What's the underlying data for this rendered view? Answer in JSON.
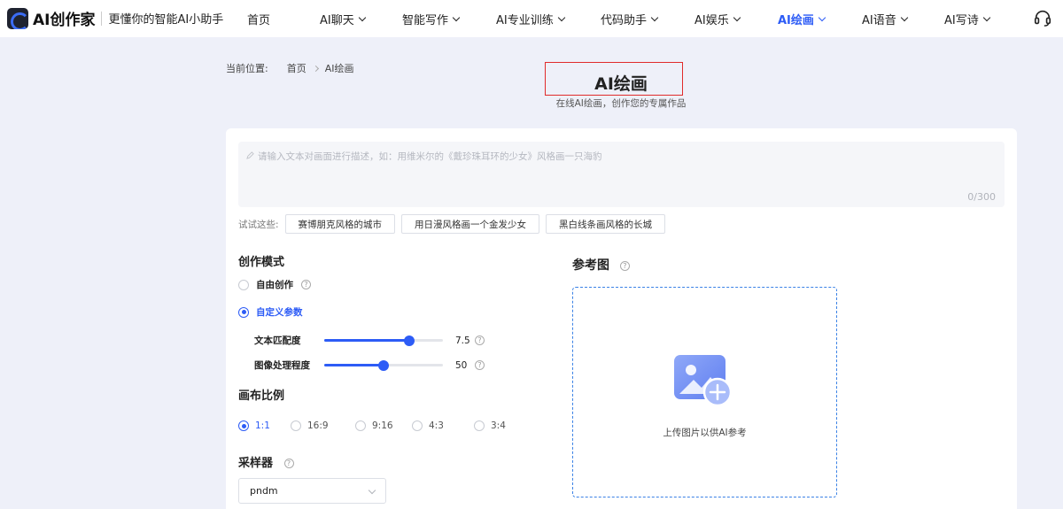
{
  "brand": {
    "name": "AI创作家",
    "slogan": "更懂你的智能AI小助手"
  },
  "nav": {
    "items": [
      {
        "label": "首页",
        "dropdown": false,
        "active": false
      },
      {
        "label": "AI聊天",
        "dropdown": true,
        "active": false
      },
      {
        "label": "智能写作",
        "dropdown": true,
        "active": false
      },
      {
        "label": "AI专业训练",
        "dropdown": true,
        "active": false
      },
      {
        "label": "代码助手",
        "dropdown": true,
        "active": false
      },
      {
        "label": "AI娱乐",
        "dropdown": true,
        "active": false
      },
      {
        "label": "AI绘画",
        "dropdown": true,
        "active": true
      },
      {
        "label": "AI语音",
        "dropdown": true,
        "active": false
      },
      {
        "label": "AI写诗",
        "dropdown": true,
        "active": false
      }
    ],
    "support_icon": "headset-icon"
  },
  "breadcrumb": {
    "prefix": "当前位置:",
    "items": [
      "首页",
      "AI绘画"
    ]
  },
  "page": {
    "title": "AI绘画",
    "subtitle": "在线AI绘画，创作您的专属作品"
  },
  "prompt": {
    "placeholder": "请输入文本对画面进行描述，如：用维米尔的《戴珍珠耳环的少女》风格画一只海豹",
    "value": "",
    "count": "0/300"
  },
  "suggestions": {
    "label": "试试这些:",
    "items": [
      "赛博朋克风格的城市",
      "用日漫风格画一个金发少女",
      "黑白线条画风格的长城"
    ]
  },
  "mode": {
    "title": "创作模式",
    "options": [
      {
        "label": "自由创作",
        "checked": false
      },
      {
        "label": "自定义参数",
        "checked": true
      }
    ]
  },
  "params": {
    "text_match": {
      "label": "文本匹配度",
      "value": "7.5",
      "fraction": 0.72
    },
    "image_strength": {
      "label": "图像处理程度",
      "value": "50",
      "fraction": 0.5
    }
  },
  "ratio": {
    "title": "画布比例",
    "options": [
      {
        "label": "1:1",
        "checked": true
      },
      {
        "label": "16:9",
        "checked": false
      },
      {
        "label": "9:16",
        "checked": false
      },
      {
        "label": "4:3",
        "checked": false
      },
      {
        "label": "3:4",
        "checked": false
      }
    ]
  },
  "sampler": {
    "title": "采样器",
    "value": "pndm"
  },
  "reference": {
    "title": "参考图",
    "upload_text": "上传图片以供AI参考"
  },
  "colors": {
    "accent": "#2d5cf6",
    "background": "#eef0f9",
    "highlight_box": "#e02b2b",
    "upload_border": "#3b82e6"
  }
}
